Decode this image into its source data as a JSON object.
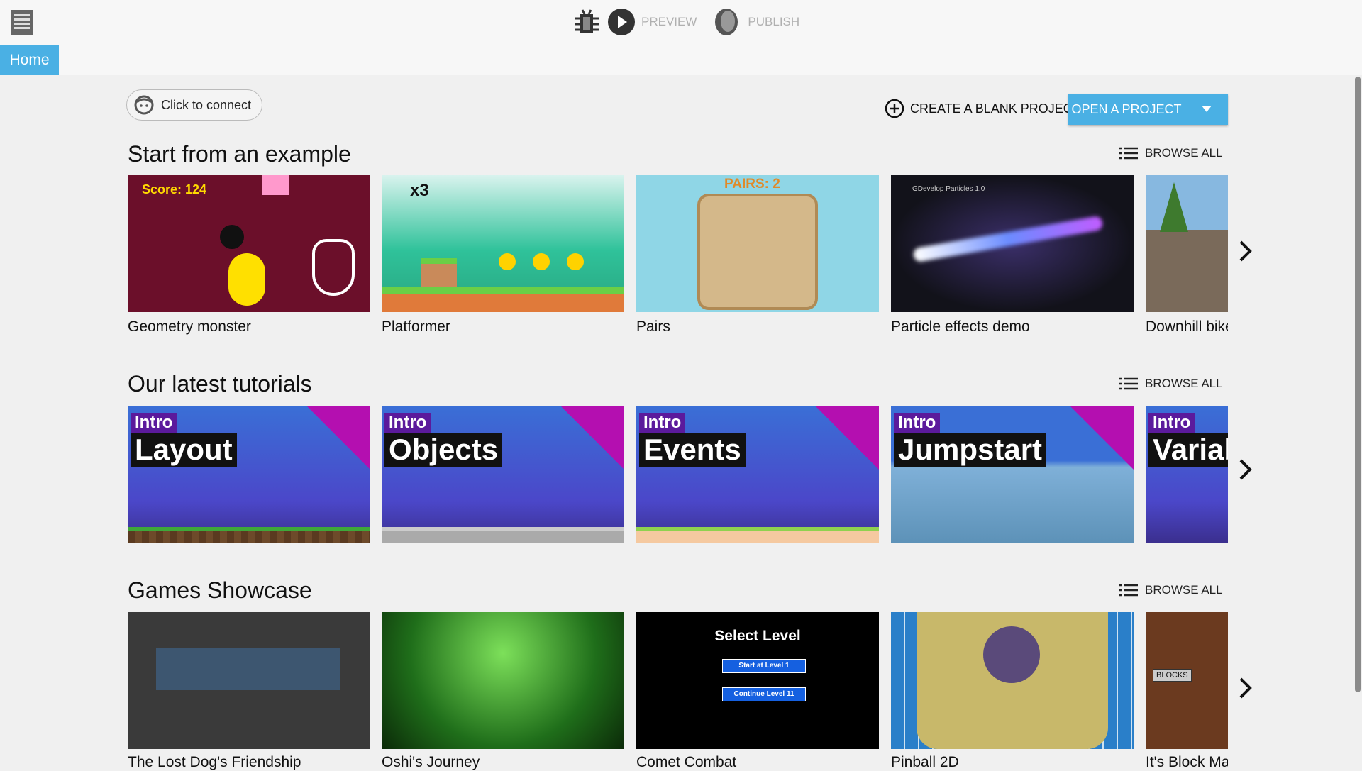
{
  "topbar": {
    "preview_label": "PREVIEW",
    "publish_label": "PUBLISH",
    "home_tab": "Home"
  },
  "actions": {
    "connect_label": "Click to connect",
    "create_blank_label": "CREATE A BLANK PROJECT",
    "open_project_label": "OPEN A PROJECT"
  },
  "sections": [
    {
      "title": "Start from an example",
      "browse_all": "BROWSE ALL",
      "items": [
        {
          "label": "Geometry monster",
          "thumb_text": "Score: 124",
          "color": "#6b0f2a"
        },
        {
          "label": "Platformer",
          "thumb_text": "x3",
          "color": "#2fc29a"
        },
        {
          "label": "Pairs",
          "thumb_text": "PAIRS: 2",
          "color": "#8fd6e6"
        },
        {
          "label": "Particle effects demo",
          "thumb_text": "GDevelop Particles 1.0",
          "color": "#1c1c24"
        },
        {
          "label": "Downhill bike",
          "color": "#87b8e0"
        }
      ]
    },
    {
      "title": "Our latest tutorials",
      "browse_all": "BROWSE ALL",
      "items": [
        {
          "intro": "Intro",
          "label": "Layout"
        },
        {
          "intro": "Intro",
          "label": "Objects"
        },
        {
          "intro": "Intro",
          "label": "Events"
        },
        {
          "intro": "Intro",
          "label": "Jumpstart"
        },
        {
          "intro": "Intro",
          "label": "Variables"
        }
      ]
    },
    {
      "title": "Games Showcase",
      "browse_all": "BROWSE ALL",
      "items": [
        {
          "label": "The Lost Dog's Friendship",
          "color": "#3a3a3a"
        },
        {
          "label": "Oshi's Journey",
          "color": "#1f6e1a"
        },
        {
          "label": "Comet Combat",
          "color": "#000000",
          "thumb_text": "Select Level",
          "btn1": "Start at Level 1",
          "btn2": "Continue Level 11"
        },
        {
          "label": "Pinball 2D",
          "color": "#2a7fc9"
        },
        {
          "label": "It's Block Mania",
          "color": "#6b3a1f",
          "thumb_text": "BLOCKS"
        }
      ]
    }
  ],
  "colors": {
    "accent": "#4ab0e4"
  }
}
